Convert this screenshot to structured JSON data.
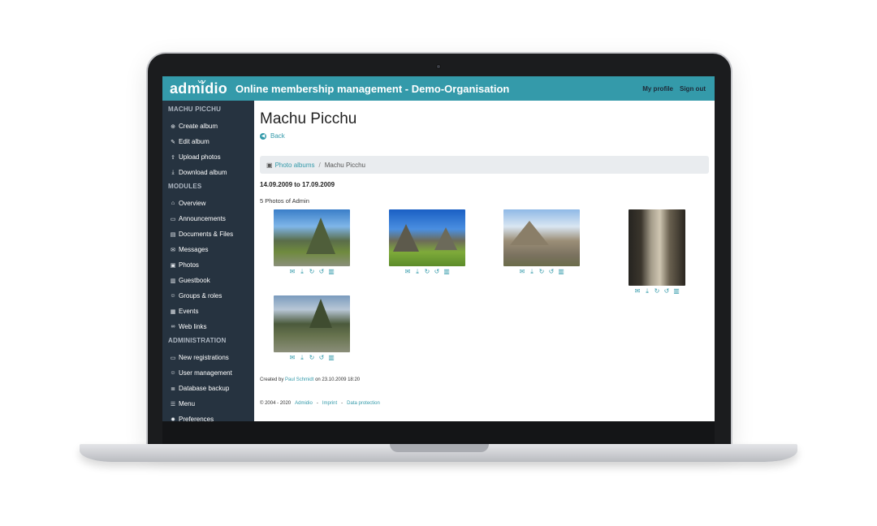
{
  "header": {
    "logo": "admidio",
    "title": "Online membership management - Demo-Organisation",
    "links": [
      "My profile",
      "Sign out"
    ]
  },
  "sidebar": {
    "album_section": "MACHU PICCHU",
    "album_items": [
      {
        "label": "Create album",
        "icon": "plus-circle-icon",
        "glyph": "⊕"
      },
      {
        "label": "Edit album",
        "icon": "edit-icon",
        "glyph": "✎"
      },
      {
        "label": "Upload photos",
        "icon": "upload-icon",
        "glyph": "⇪"
      },
      {
        "label": "Download album",
        "icon": "download-icon",
        "glyph": "⤓"
      }
    ],
    "modules_section": "MODULES",
    "module_items": [
      {
        "label": "Overview",
        "icon": "home-icon",
        "glyph": "⌂"
      },
      {
        "label": "Announcements",
        "icon": "announcement-icon",
        "glyph": "▭"
      },
      {
        "label": "Documents & Files",
        "icon": "file-icon",
        "glyph": "▤"
      },
      {
        "label": "Messages",
        "icon": "comments-icon",
        "glyph": "✉"
      },
      {
        "label": "Photos",
        "icon": "image-icon",
        "glyph": "▣"
      },
      {
        "label": "Guestbook",
        "icon": "book-icon",
        "glyph": "▥"
      },
      {
        "label": "Groups & roles",
        "icon": "users-icon",
        "glyph": "☺"
      },
      {
        "label": "Events",
        "icon": "calendar-icon",
        "glyph": "▦"
      },
      {
        "label": "Web links",
        "icon": "link-icon",
        "glyph": "∞"
      }
    ],
    "admin_section": "ADMINISTRATION",
    "admin_items": [
      {
        "label": "New registrations",
        "icon": "id-card-icon",
        "glyph": "▭"
      },
      {
        "label": "User management",
        "icon": "user-cog-icon",
        "glyph": "☺"
      },
      {
        "label": "Database backup",
        "icon": "database-icon",
        "glyph": "≣"
      },
      {
        "label": "Menu",
        "icon": "menu-icon",
        "glyph": "☰"
      },
      {
        "label": "Preferences",
        "icon": "cog-icon",
        "glyph": "✹"
      }
    ]
  },
  "main": {
    "title": "Machu Picchu",
    "back_label": "Back",
    "breadcrumb": {
      "root": "Photo albums",
      "current": "Machu Picchu"
    },
    "date_range": "14.09.2009 to 17.09.2009",
    "photo_count": "5 Photos of Admin",
    "photos": [
      {
        "name": "photo-1",
        "actions": [
          "envelope-icon",
          "download-icon",
          "rotate-right-icon",
          "rotate-left-icon",
          "trash-icon"
        ]
      },
      {
        "name": "photo-2",
        "actions": [
          "envelope-icon",
          "download-icon",
          "rotate-right-icon",
          "rotate-left-icon",
          "trash-icon"
        ]
      },
      {
        "name": "photo-3",
        "actions": [
          "envelope-icon",
          "download-icon",
          "rotate-right-icon",
          "rotate-left-icon",
          "trash-icon"
        ]
      },
      {
        "name": "photo-4",
        "actions": [
          "envelope-icon",
          "download-icon",
          "rotate-right-icon",
          "rotate-left-icon",
          "trash-icon"
        ]
      },
      {
        "name": "photo-5",
        "actions": [
          "envelope-icon",
          "download-icon",
          "rotate-right-icon",
          "rotate-left-icon",
          "trash-icon"
        ]
      }
    ],
    "created_prefix": "Created by",
    "created_by": "Paul Schmidt",
    "created_on": "on 23.10.2009 18:20"
  },
  "footer": {
    "copyright": "© 2004 - 2020",
    "brand": "Admidio",
    "links": [
      "Imprint",
      "Data protection"
    ],
    "separator": "-"
  },
  "colors": {
    "accent": "#349aaa",
    "sidebar_bg": "#263340",
    "breadcrumb_bg": "#e9ecef"
  }
}
